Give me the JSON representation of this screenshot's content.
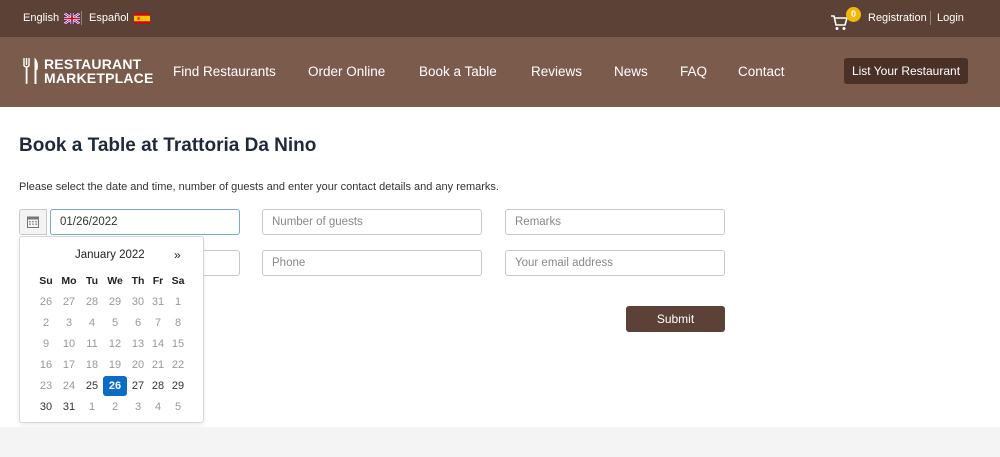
{
  "topbar": {
    "lang_english": "English",
    "lang_spanish": "Español",
    "cart_count": "0",
    "registration": "Registration",
    "login": "Login",
    "icons": [
      "uk-flag-icon",
      "spain-flag-icon",
      "cart-icon"
    ]
  },
  "nav": {
    "logo_line1": "RESTAURANT",
    "logo_line2": "MARKETPLACE",
    "items": [
      "Find Restaurants",
      "Order Online",
      "Book a Table",
      "Reviews",
      "News",
      "FAQ",
      "Contact"
    ],
    "cta": "List Your Restaurant"
  },
  "booking": {
    "title_prefix": "Book a Table at",
    "restaurant": "Trattoria Da Nino",
    "instructions": "Please select the date and time, number of guests and enter your contact details and any remarks.",
    "date_value": "01/26/2022",
    "guests_placeholder": "Number of guests",
    "remarks_placeholder": "Remarks",
    "phone_placeholder": "Phone",
    "email_placeholder": "Your email address",
    "submit": "Submit"
  },
  "datepicker": {
    "month": "January 2022",
    "next": "»",
    "dow": [
      "Su",
      "Mo",
      "Tu",
      "We",
      "Th",
      "Fr",
      "Sa"
    ],
    "weeks": [
      [
        "26",
        "27",
        "28",
        "29",
        "30",
        "31",
        "1"
      ],
      [
        "2",
        "3",
        "4",
        "5",
        "6",
        "7",
        "8"
      ],
      [
        "9",
        "10",
        "11",
        "12",
        "13",
        "14",
        "15"
      ],
      [
        "16",
        "17",
        "18",
        "19",
        "20",
        "21",
        "22"
      ],
      [
        "23",
        "24",
        "25",
        "26",
        "27",
        "28",
        "29"
      ],
      [
        "30",
        "31",
        "1",
        "2",
        "3",
        "4",
        "5"
      ]
    ],
    "selected": "26",
    "enabled_from": "25",
    "colors": {
      "selected": "#0b6bc7"
    }
  },
  "colors": {
    "topbar": "#5c4236",
    "navbar": "#7b5b4c",
    "button_dark": "#4a3128",
    "badge": "#f2b807"
  }
}
